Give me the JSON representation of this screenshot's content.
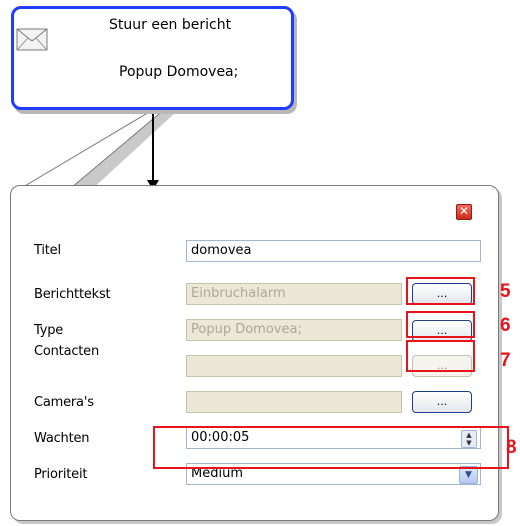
{
  "node": {
    "title": "Stuur een bericht",
    "subtitle": "Popup Domovea;",
    "icon": "envelope-icon"
  },
  "dialog": {
    "close_icon": "close-icon",
    "close_symbol": "✕",
    "fields": {
      "titel": {
        "label": "Titel",
        "value": "domovea"
      },
      "berichttekst": {
        "label": "Berichttekst",
        "value": "Einbruchalarm",
        "button": "..."
      },
      "type": {
        "label": "Type",
        "value": "Popup Domovea;",
        "button": "..."
      },
      "contacten": {
        "label": "Contacten",
        "value": "",
        "button": "..."
      },
      "cameras": {
        "label": "Camera's",
        "value": "",
        "button": "..."
      },
      "wachten": {
        "label": "Wachten",
        "value": "00:00:05",
        "spinner_icon": "spinner-icon"
      },
      "prioriteit": {
        "label": "Prioriteit",
        "value": "Medium",
        "dropdown_icon": "chevron-down-icon"
      }
    }
  },
  "callouts": [
    "5",
    "6",
    "7",
    "8"
  ],
  "colors": {
    "node_border": "#1f3cff",
    "callout": "#e8141b",
    "disabled_field": "#ece8d8"
  }
}
